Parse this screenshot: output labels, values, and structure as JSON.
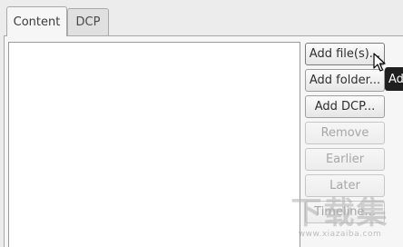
{
  "tabs": [
    {
      "label": "Content",
      "active": true
    },
    {
      "label": "DCP",
      "active": false
    }
  ],
  "buttons": [
    {
      "label": "Add file(s)...",
      "enabled": true
    },
    {
      "label": "Add folder...",
      "enabled": true
    },
    {
      "label": "Add DCP...",
      "enabled": true
    },
    {
      "label": "Remove",
      "enabled": false
    },
    {
      "label": "Earlier",
      "enabled": false
    },
    {
      "label": "Later",
      "enabled": false
    },
    {
      "label": "Timeline...",
      "enabled": false
    }
  ],
  "tooltip": {
    "text": "Ad"
  },
  "watermark": {
    "logo": "下载集",
    "url": "www.xiazaiba.com"
  }
}
